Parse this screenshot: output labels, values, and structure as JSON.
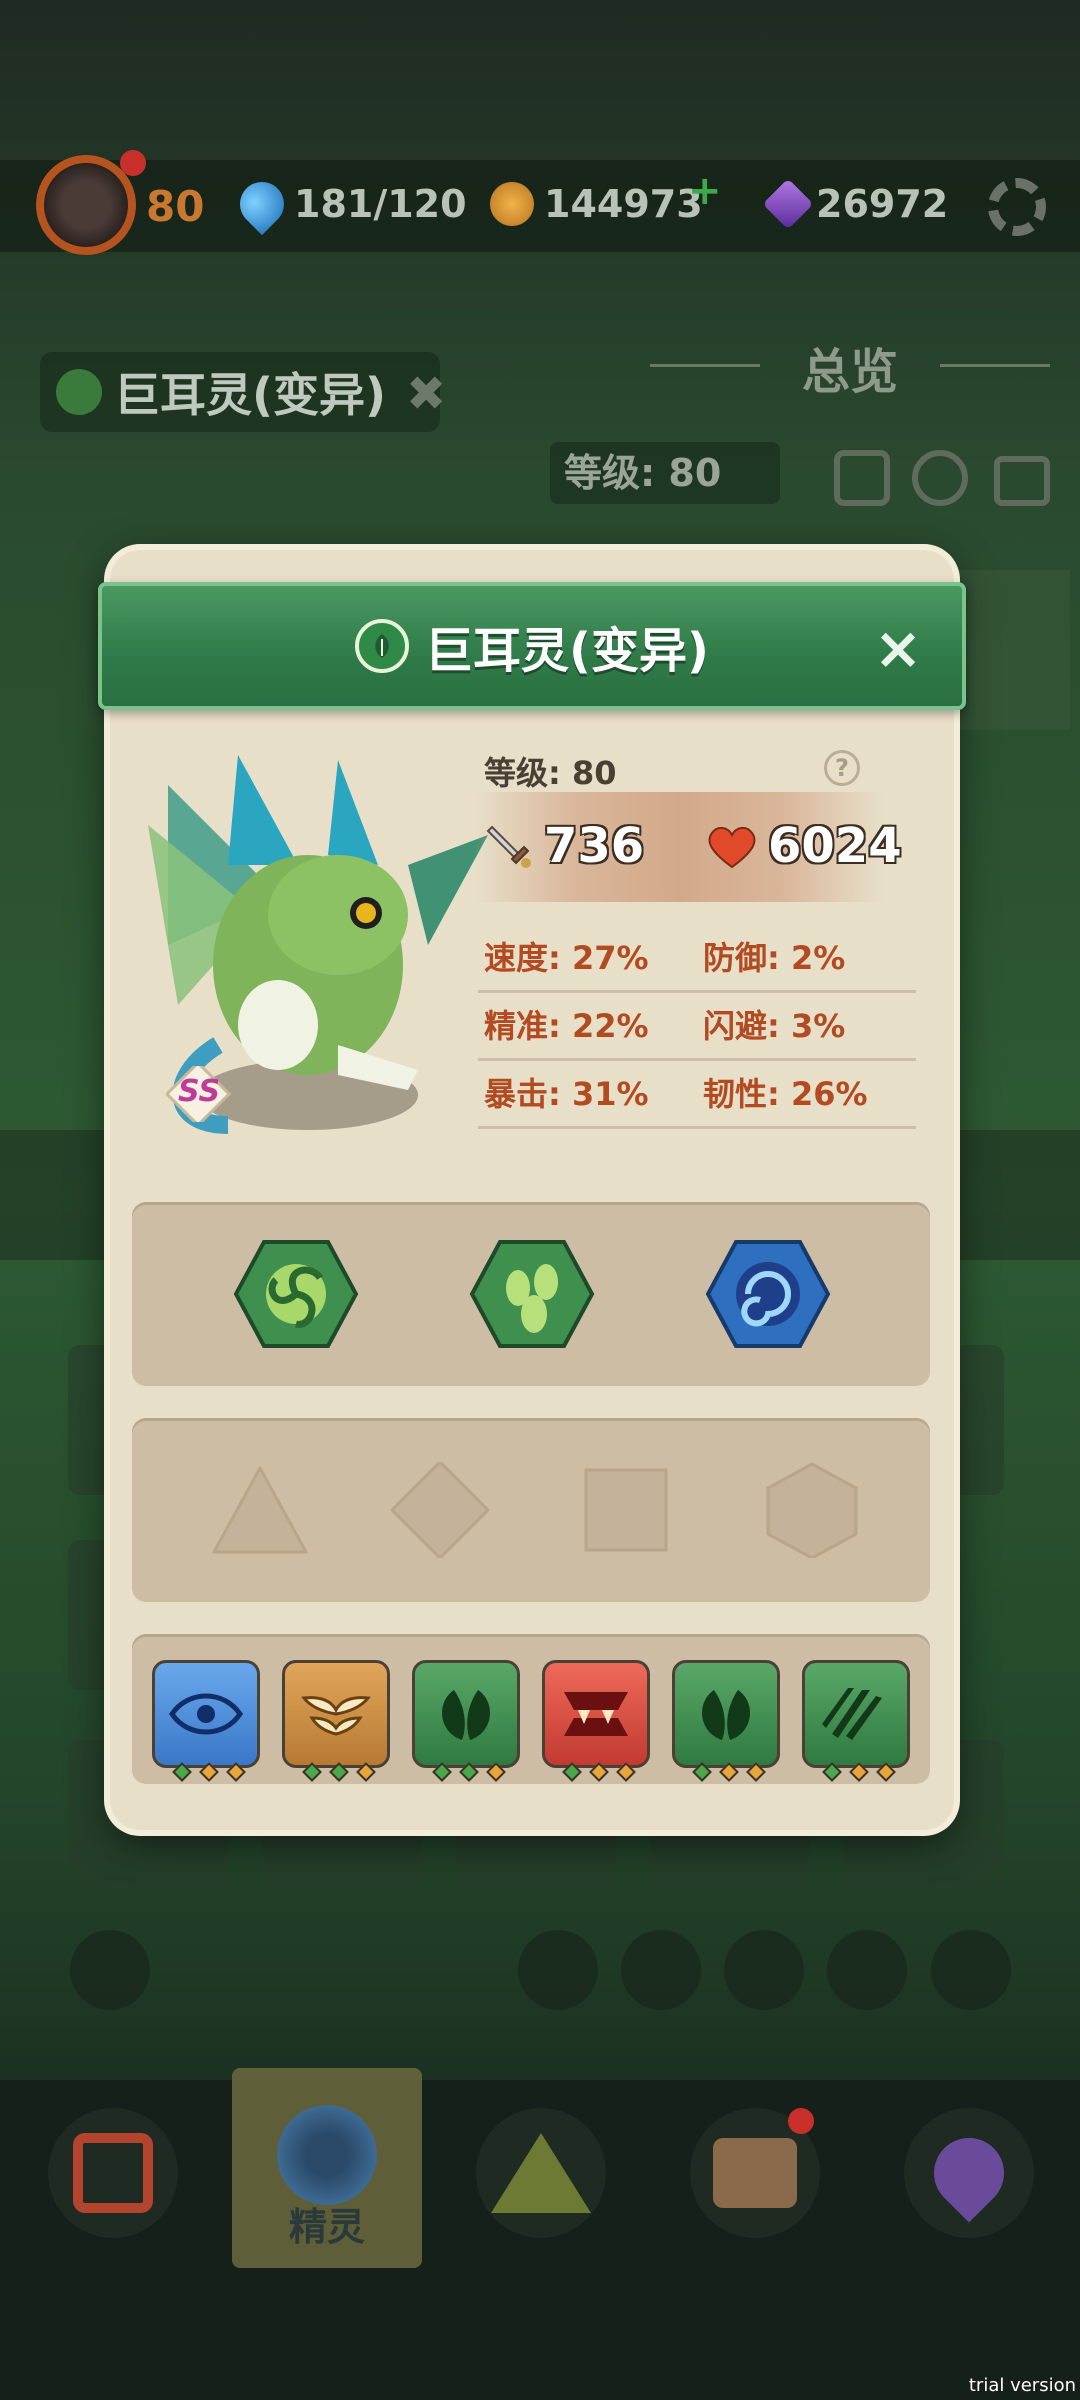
{
  "topbar": {
    "player_level": "80",
    "water": "181/120",
    "gold": "144973",
    "gems": "26972",
    "plus_label": "+"
  },
  "background": {
    "creature_name": "巨耳灵(变异)",
    "overview_label": "总览",
    "level_label": "等级: 80"
  },
  "modal": {
    "title": "巨耳灵(变异)",
    "close_label": "×",
    "rank": "SS",
    "level_label": "等级: 80",
    "help_label": "?",
    "attack": "736",
    "hp": "6024",
    "stats": [
      {
        "label": "速度: 27%"
      },
      {
        "label": "防御: 2%"
      },
      {
        "label": "精准: 22%"
      },
      {
        "label": "闪避: 3%"
      },
      {
        "label": "暴击: 31%"
      },
      {
        "label": "韧性: 26%"
      }
    ],
    "skills": [
      {
        "icon": "leaf-swirl-icon",
        "color": "#3f8f4e"
      },
      {
        "icon": "seeds-icon",
        "color": "#3f8f4e"
      },
      {
        "icon": "vortex-icon",
        "color": "#2f6fc0"
      }
    ],
    "slots": [
      "triangle-slot-icon",
      "diamond-slot-icon",
      "square-slot-icon",
      "hexagon-slot-icon"
    ],
    "traits": [
      {
        "icon": "eye-icon",
        "color": "#4f8fd8"
      },
      {
        "icon": "wings-icon",
        "color": "#c98a45"
      },
      {
        "icon": "leaf-pair-icon",
        "color": "#3f8f4e"
      },
      {
        "icon": "fangs-icon",
        "color": "#d84a3e"
      },
      {
        "icon": "leaf-pair-icon",
        "color": "#3f8f4e"
      },
      {
        "icon": "claw-slash-icon",
        "color": "#3f8f4e"
      }
    ]
  },
  "nav": {
    "spirit_label": "精灵"
  },
  "watermark": "trial version"
}
